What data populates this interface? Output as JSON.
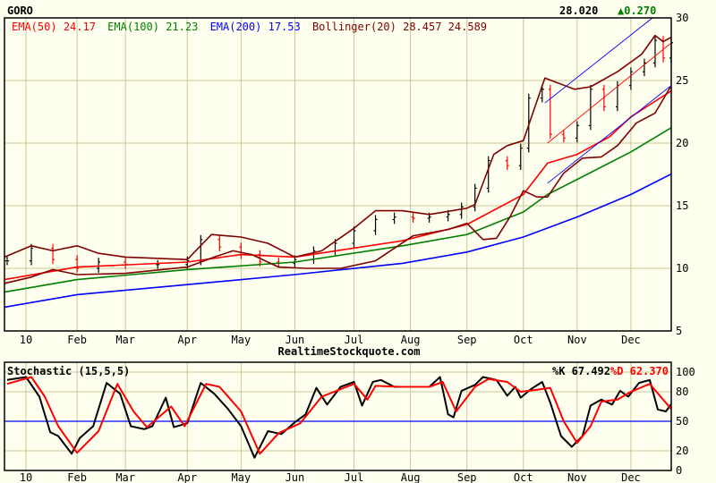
{
  "header": {
    "symbol": "GORO",
    "last": "28.020",
    "change": "▲0.270",
    "source": "RealtimeStockquote.com"
  },
  "colors": {
    "ema50": "#ff0000",
    "ema100": "#008000",
    "ema200": "#0000ff",
    "bollinger": "#800000",
    "up": "#000000",
    "down": "#ff0000",
    "grid": "#c8c896",
    "change": "#008000"
  },
  "legend": [
    {
      "label": "EMA(50)",
      "value": "24.17",
      "color": "#ff0000"
    },
    {
      "label": "EMA(100)",
      "value": "21.23",
      "color": "#008000"
    },
    {
      "label": "EMA(200)",
      "value": "17.53",
      "color": "#0000ff"
    },
    {
      "label": "Bollinger(20)",
      "value": "28.457 24.589",
      "color": "#800000"
    }
  ],
  "chart_data": [
    {
      "type": "line",
      "title": "GORO",
      "xlim": [
        0,
        248
      ],
      "ylim": [
        5,
        30
      ],
      "yticks": [
        5,
        10,
        15,
        20,
        25,
        30
      ],
      "xticks": [
        {
          "x": 8,
          "label": "10"
        },
        {
          "x": 27,
          "label": "Feb"
        },
        {
          "x": 45,
          "label": "Mar"
        },
        {
          "x": 68,
          "label": "Apr"
        },
        {
          "x": 88,
          "label": "May"
        },
        {
          "x": 108,
          "label": "Jun"
        },
        {
          "x": 130,
          "label": "Jul"
        },
        {
          "x": 151,
          "label": "Aug"
        },
        {
          "x": 172,
          "label": "Sep"
        },
        {
          "x": 193,
          "label": "Oct"
        },
        {
          "x": 213,
          "label": "Nov"
        },
        {
          "x": 233,
          "label": "Dec"
        }
      ],
      "grid": true,
      "price": [
        [
          1,
          10.6
        ],
        [
          10,
          11.6
        ],
        [
          18,
          10.7
        ],
        [
          27,
          10
        ],
        [
          35,
          10.5
        ],
        [
          45,
          10.3
        ],
        [
          57,
          10.3
        ],
        [
          68,
          10.6
        ],
        [
          73,
          12.3
        ],
        [
          80,
          11.7
        ],
        [
          88,
          11.1
        ],
        [
          95,
          10.5
        ],
        [
          102,
          10.4
        ],
        [
          108,
          10.7
        ],
        [
          115,
          11.4
        ],
        [
          123,
          12
        ],
        [
          130,
          13
        ],
        [
          138,
          13.9
        ],
        [
          145,
          14.1
        ],
        [
          152,
          14
        ],
        [
          158,
          14.1
        ],
        [
          165,
          14.3
        ],
        [
          170,
          14.9
        ],
        [
          175,
          16.4
        ],
        [
          180,
          18.6
        ],
        [
          187,
          18.2
        ],
        [
          192,
          19.6
        ],
        [
          195,
          23.6
        ],
        [
          200,
          24.3
        ],
        [
          203,
          20.7
        ],
        [
          208,
          20.4
        ],
        [
          213,
          21.4
        ],
        [
          218,
          24.3
        ],
        [
          223,
          22.9
        ],
        [
          228,
          24.6
        ],
        [
          233,
          25.7
        ],
        [
          238,
          26.4
        ],
        [
          242,
          28.2
        ],
        [
          245,
          26.8
        ],
        [
          248,
          28.02
        ]
      ],
      "series": [
        {
          "name": "EMA(50)",
          "color": "#ff0000",
          "points": [
            [
              0,
              9.1
            ],
            [
              27,
              10.1
            ],
            [
              68,
              10.5
            ],
            [
              88,
              11.1
            ],
            [
              108,
              10.9
            ],
            [
              148,
              12.2
            ],
            [
              172,
              13.5
            ],
            [
              193,
              15.9
            ],
            [
              202,
              18.4
            ],
            [
              213,
              19.1
            ],
            [
              225,
              20.5
            ],
            [
              233,
              22.1
            ],
            [
              248,
              24.17
            ]
          ]
        },
        {
          "name": "EMA(100)",
          "color": "#008000",
          "points": [
            [
              0,
              8.1
            ],
            [
              27,
              9.1
            ],
            [
              68,
              9.9
            ],
            [
              108,
              10.5
            ],
            [
              148,
              11.8
            ],
            [
              172,
              12.7
            ],
            [
              193,
              14.5
            ],
            [
              202,
              15.9
            ],
            [
              213,
              17.1
            ],
            [
              233,
              19.3
            ],
            [
              248,
              21.23
            ]
          ]
        },
        {
          "name": "EMA(200)",
          "color": "#0000ff",
          "points": [
            [
              0,
              6.9
            ],
            [
              27,
              7.9
            ],
            [
              68,
              8.7
            ],
            [
              108,
              9.5
            ],
            [
              148,
              10.4
            ],
            [
              172,
              11.3
            ],
            [
              193,
              12.5
            ],
            [
              213,
              14.1
            ],
            [
              233,
              15.9
            ],
            [
              248,
              17.53
            ]
          ]
        },
        {
          "name": "Bollinger upper",
          "color": "#800000",
          "points": [
            [
              0,
              10.9
            ],
            [
              10,
              11.8
            ],
            [
              18,
              11.4
            ],
            [
              27,
              11.8
            ],
            [
              35,
              11.2
            ],
            [
              45,
              10.9
            ],
            [
              68,
              10.7
            ],
            [
              77,
              12.7
            ],
            [
              88,
              12.5
            ],
            [
              98,
              12
            ],
            [
              108,
              10.9
            ],
            [
              118,
              11.4
            ],
            [
              130,
              13.2
            ],
            [
              138,
              14.6
            ],
            [
              148,
              14.6
            ],
            [
              158,
              14.3
            ],
            [
              172,
              14.8
            ],
            [
              175,
              15.1
            ],
            [
              182,
              19.1
            ],
            [
              187,
              19.8
            ],
            [
              193,
              20.2
            ],
            [
              201,
              25.2
            ],
            [
              212,
              24.3
            ],
            [
              218,
              24.5
            ],
            [
              228,
              25.7
            ],
            [
              237,
              27.1
            ],
            [
              242,
              28.6
            ],
            [
              245,
              28.1
            ],
            [
              248,
              28.457
            ]
          ]
        },
        {
          "name": "Bollinger lower",
          "color": "#800000",
          "points": [
            [
              0,
              8.8
            ],
            [
              10,
              9.3
            ],
            [
              18,
              9.9
            ],
            [
              27,
              9.5
            ],
            [
              45,
              9.6
            ],
            [
              68,
              10.1
            ],
            [
              78,
              10.9
            ],
            [
              85,
              11.4
            ],
            [
              92,
              11.1
            ],
            [
              102,
              10.1
            ],
            [
              112,
              10
            ],
            [
              125,
              10
            ],
            [
              138,
              10.6
            ],
            [
              152,
              12.6
            ],
            [
              165,
              13.1
            ],
            [
              172,
              13.6
            ],
            [
              178,
              12.3
            ],
            [
              183,
              12.4
            ],
            [
              188,
              14.1
            ],
            [
              193,
              16.2
            ],
            [
              198,
              15.7
            ],
            [
              202,
              15.7
            ],
            [
              208,
              17.6
            ],
            [
              215,
              18.8
            ],
            [
              222,
              18.9
            ],
            [
              228,
              19.8
            ],
            [
              235,
              21.6
            ],
            [
              242,
              22.4
            ],
            [
              248,
              24.589
            ]
          ]
        }
      ],
      "trendlines": [
        {
          "color": "#0000ff",
          "points": [
            [
              201,
              23.2
            ],
            [
              241,
              30
            ]
          ]
        },
        {
          "color": "#0000ff",
          "points": [
            [
              202,
              16.8
            ],
            [
              248,
              24.6
            ]
          ]
        },
        {
          "color": "#ff0000",
          "points": [
            [
              202,
              20
            ],
            [
              248,
              28
            ]
          ]
        }
      ]
    },
    {
      "type": "line",
      "title": "Stochastic (15,5,5)",
      "xlim": [
        0,
        248
      ],
      "ylim": [
        0,
        100
      ],
      "yticks": [
        0,
        20,
        50,
        80,
        100
      ],
      "reference_line": 50,
      "k_label": "%K 67.492",
      "d_label": "%D 62.370",
      "series": [
        {
          "name": "%K",
          "color": "#000000",
          "points": [
            [
              1,
              92
            ],
            [
              8,
              95
            ],
            [
              13,
              75
            ],
            [
              17,
              39
            ],
            [
              20,
              35
            ],
            [
              25,
              17
            ],
            [
              28,
              33
            ],
            [
              33,
              45
            ],
            [
              38,
              89
            ],
            [
              43,
              78
            ],
            [
              47,
              45
            ],
            [
              52,
              42
            ],
            [
              55,
              45
            ],
            [
              60,
              74
            ],
            [
              63,
              44
            ],
            [
              68,
              48
            ],
            [
              73,
              89
            ],
            [
              78,
              78
            ],
            [
              83,
              63
            ],
            [
              88,
              45
            ],
            [
              93,
              13
            ],
            [
              98,
              40
            ],
            [
              103,
              37
            ],
            [
              108,
              49
            ],
            [
              112,
              57
            ],
            [
              116,
              84
            ],
            [
              120,
              67
            ],
            [
              125,
              85
            ],
            [
              130,
              90
            ],
            [
              133,
              66
            ],
            [
              137,
              90
            ],
            [
              140,
              92
            ],
            [
              145,
              85
            ],
            [
              150,
              85
            ],
            [
              158,
              85
            ],
            [
              162,
              95
            ],
            [
              165,
              57
            ],
            [
              167,
              54
            ],
            [
              170,
              81
            ],
            [
              175,
              87
            ],
            [
              178,
              95
            ],
            [
              183,
              92
            ],
            [
              187,
              76
            ],
            [
              190,
              85
            ],
            [
              192,
              74
            ],
            [
              196,
              83
            ],
            [
              200,
              90
            ],
            [
              203,
              69
            ],
            [
              207,
              35
            ],
            [
              211,
              24
            ],
            [
              215,
              35
            ],
            [
              218,
              66
            ],
            [
              222,
              72
            ],
            [
              226,
              67
            ],
            [
              229,
              81
            ],
            [
              232,
              75
            ],
            [
              236,
              89
            ],
            [
              240,
              92
            ],
            [
              243,
              62
            ],
            [
              246,
              60
            ],
            [
              248,
              67.492
            ]
          ]
        },
        {
          "name": "%D",
          "color": "#ff0000",
          "points": [
            [
              1,
              88
            ],
            [
              10,
              95
            ],
            [
              15,
              75
            ],
            [
              20,
              45
            ],
            [
              27,
              18
            ],
            [
              35,
              40
            ],
            [
              42,
              88
            ],
            [
              48,
              60
            ],
            [
              53,
              44
            ],
            [
              62,
              65
            ],
            [
              67,
              45
            ],
            [
              75,
              88
            ],
            [
              80,
              85
            ],
            [
              88,
              60
            ],
            [
              95,
              17
            ],
            [
              102,
              38
            ],
            [
              110,
              48
            ],
            [
              118,
              75
            ],
            [
              130,
              88
            ],
            [
              135,
              72
            ],
            [
              138,
              86
            ],
            [
              147,
              85
            ],
            [
              158,
              85
            ],
            [
              163,
              90
            ],
            [
              168,
              60
            ],
            [
              175,
              85
            ],
            [
              180,
              93
            ],
            [
              187,
              90
            ],
            [
              192,
              80
            ],
            [
              198,
              82
            ],
            [
              203,
              84
            ],
            [
              208,
              50
            ],
            [
              213,
              28
            ],
            [
              218,
              45
            ],
            [
              222,
              70
            ],
            [
              228,
              72
            ],
            [
              233,
              80
            ],
            [
              240,
              88
            ],
            [
              248,
              62.37
            ]
          ]
        }
      ]
    }
  ]
}
